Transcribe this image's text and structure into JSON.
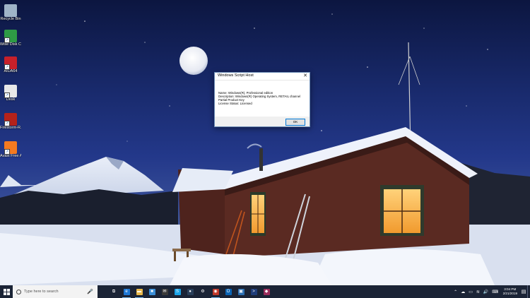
{
  "desktop_icons": [
    {
      "label": "Recycle Bin",
      "icon": "recycle-bin-icon",
      "color": "#9fb4c8"
    },
    {
      "label": "Wise Disk Cleaner",
      "icon": "wise-disk-cleaner-icon",
      "color": "#2e9b45"
    },
    {
      "label": "AIDA64",
      "icon": "aida64-icon",
      "color": "#c7202a"
    },
    {
      "label": "Desk",
      "icon": "desk-folder-icon",
      "color": "#e8e8e8"
    },
    {
      "label": "Firestorm-R...",
      "icon": "firestorm-icon",
      "color": "#b5221a"
    },
    {
      "label": "Avast Free Antivirus",
      "icon": "avast-icon",
      "color": "#f47a20"
    }
  ],
  "dialog": {
    "title": "Windows Script Host",
    "close": "✕",
    "lines": [
      "Name: Windows(R), Professional edition",
      "Description: Windows(R) Operating System, RETAIL channel",
      "Partial Product Key",
      "License Status: Licensed"
    ],
    "ok_label": "OK"
  },
  "taskbar": {
    "search_placeholder": "Type here to search",
    "apps": [
      {
        "name": "task-view",
        "glyph": "⧉",
        "color": "#1b2436"
      },
      {
        "name": "edge",
        "glyph": "e",
        "color": "#1e78d6"
      },
      {
        "name": "file-explorer",
        "glyph": "▬",
        "color": "#e8b84a"
      },
      {
        "name": "store",
        "glyph": "■",
        "color": "#3b8fd8"
      },
      {
        "name": "mail",
        "glyph": "✉",
        "color": "#3a3a3a"
      },
      {
        "name": "skype",
        "glyph": "S",
        "color": "#1aa3e8"
      },
      {
        "name": "steam",
        "glyph": "●",
        "color": "#2a3f5a"
      },
      {
        "name": "settings",
        "glyph": "⚙",
        "color": "#1b2436"
      },
      {
        "name": "firestorm",
        "glyph": "◉",
        "color": "#c0392b"
      },
      {
        "name": "outlook",
        "glyph": "O",
        "color": "#0a64b5"
      },
      {
        "name": "photos",
        "glyph": "▣",
        "color": "#2b6fb3"
      },
      {
        "name": "powershell",
        "glyph": ">",
        "color": "#1f3d7a"
      },
      {
        "name": "remote-app",
        "glyph": "◆",
        "color": "#9b2d5c"
      }
    ],
    "tray": [
      "⌃",
      "☁",
      "▭",
      "≋",
      "🔊",
      "⌨"
    ],
    "time": "3:04 PM",
    "date": "2/21/2019"
  }
}
